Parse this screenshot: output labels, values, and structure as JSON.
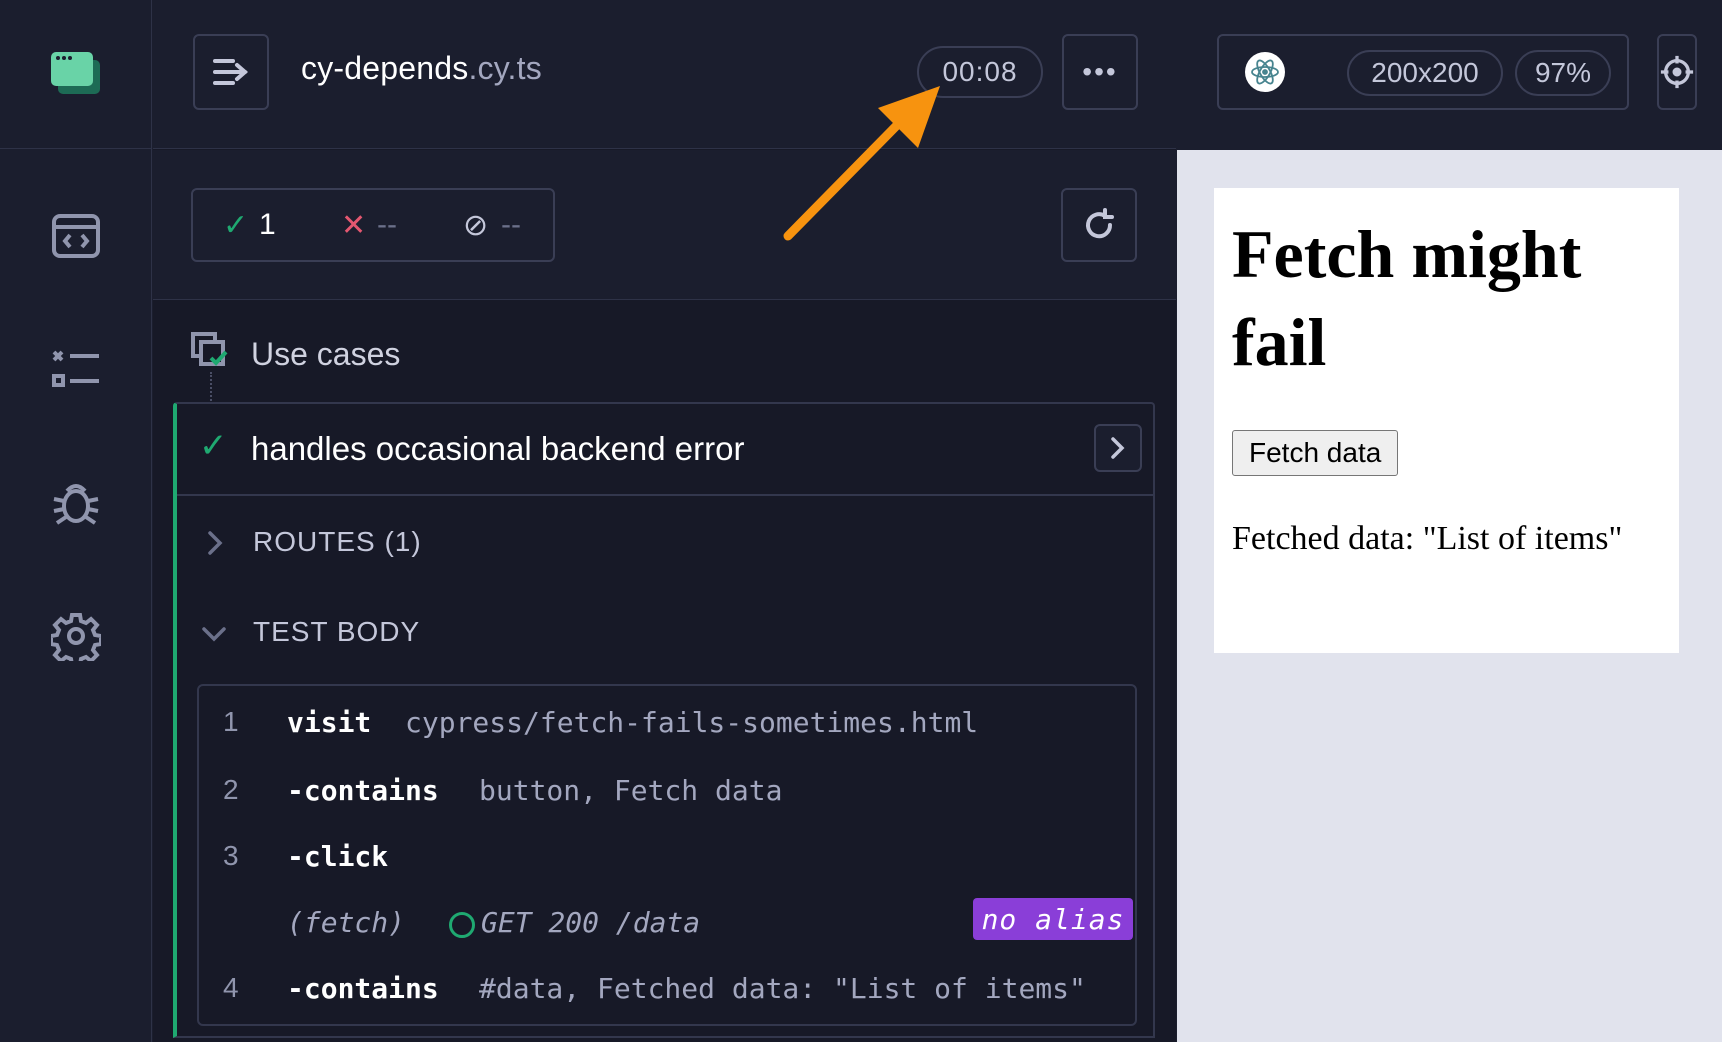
{
  "nav": {
    "items": [
      {
        "name": "specs",
        "icon": "code-window-icon"
      },
      {
        "name": "runs",
        "icon": "checklist-icon"
      },
      {
        "name": "debug",
        "icon": "bug-icon"
      },
      {
        "name": "settings",
        "icon": "gear-icon"
      }
    ]
  },
  "header": {
    "spec_base": "cy-depends",
    "spec_ext": ".cy.ts",
    "timer": "00:08",
    "menu_label": "•••"
  },
  "stats": {
    "passed": "1",
    "failed": "--",
    "pending": "--"
  },
  "suite": {
    "title": "Use cases"
  },
  "test": {
    "title": "handles occasional backend error",
    "routes_label": "ROUTES (1)",
    "body_label": "TEST BODY",
    "commands": [
      {
        "num": "1",
        "name": "visit",
        "message": "cypress/fetch-fails-sometimes.html"
      },
      {
        "num": "2",
        "name": "-contains",
        "message": "button, Fetch data"
      },
      {
        "num": "3",
        "name": "-click",
        "message": ""
      },
      {
        "num": "",
        "name": "(fetch)",
        "message": "GET 200 /data",
        "badge": "no alias"
      },
      {
        "num": "4",
        "name": "-contains",
        "message": "#data, Fetched data: \"List of items\""
      }
    ]
  },
  "aut": {
    "viewport": "200x200",
    "scale": "97%",
    "heading": "Fetch might fail",
    "button": "Fetch data",
    "result": "Fetched data: \"List of items\""
  },
  "colors": {
    "pass": "#1fa971",
    "fail": "#e45770",
    "alias_badge": "#8a3ed8",
    "annotation": "#f7930f"
  }
}
